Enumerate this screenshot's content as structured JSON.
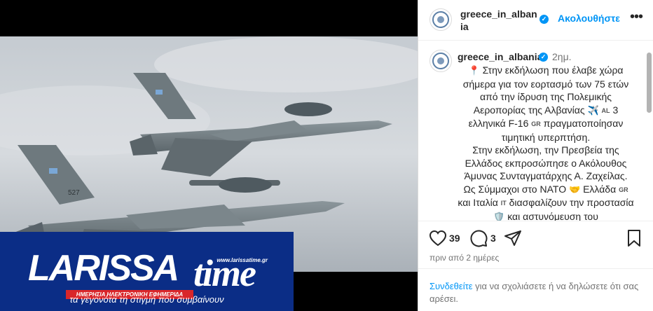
{
  "media": {
    "brand_url": "www.larissatime.gr",
    "brand_larissa": "LARISSA",
    "brand_time": "time",
    "brand_strip": "ΗΜΕΡΗΣΙΑ ΗΛΕΚΤΡΟΝΙΚΗ ΕΦΗΜΕΡΙΔΑ",
    "brand_tagline": "τα γεγονότα τη στιγμή που συμβαίνουν",
    "jet_tail_number": "527"
  },
  "header": {
    "username": "greece_in_albania",
    "follow_label": "Ακολουθήστε",
    "more": "•••"
  },
  "caption": {
    "username": "greece_in_albania",
    "time": "2ημ.",
    "pin_emoji": "📍",
    "line1": "Στην εκδήλωση που έλαβε χώρα σήμερα για τον εορτασμό των 75 ετών από την ίδρυση της Πολεμικής Αεροπορίας της Αλβανίας",
    "plane_emoji": "✈️",
    "flag_al": "AL",
    "line2": "3 ελληνικά F-16",
    "flag_gr1": "GR",
    "line3": "πραγματοποίησαν τιμητική υπερπτήση.",
    "line4": "Στην εκδήλωση, την Πρεσβεία της Ελλάδος εκπροσώπησε ο Ακόλουθος Άμυνας Συνταγματάρχης Α. Ζαχείλας.",
    "line5": "Ως Σύμμαχοι στο ΝΑΤΟ",
    "handshake_emoji": "🤝",
    "line6": "Ελλάδα",
    "flag_gr2": "GR",
    "line7": "και Ιταλία",
    "flag_it": "IT",
    "line8": "διασφαλίζουν την προστασία",
    "shield_emoji": "🛡️",
    "line9": "και αστυνόμευση του"
  },
  "actions": {
    "likes": "39",
    "comments": "3",
    "posted": "πριν από 2 ημέρες"
  },
  "login": {
    "link": "Συνδεθείτε",
    "text": " για να σχολιάσετε ή να δηλώσετε ότι σας αρέσει."
  },
  "colors": {
    "accent": "#0095f6",
    "brand_bg": "#0b2d86",
    "brand_red": "#d9262a"
  }
}
